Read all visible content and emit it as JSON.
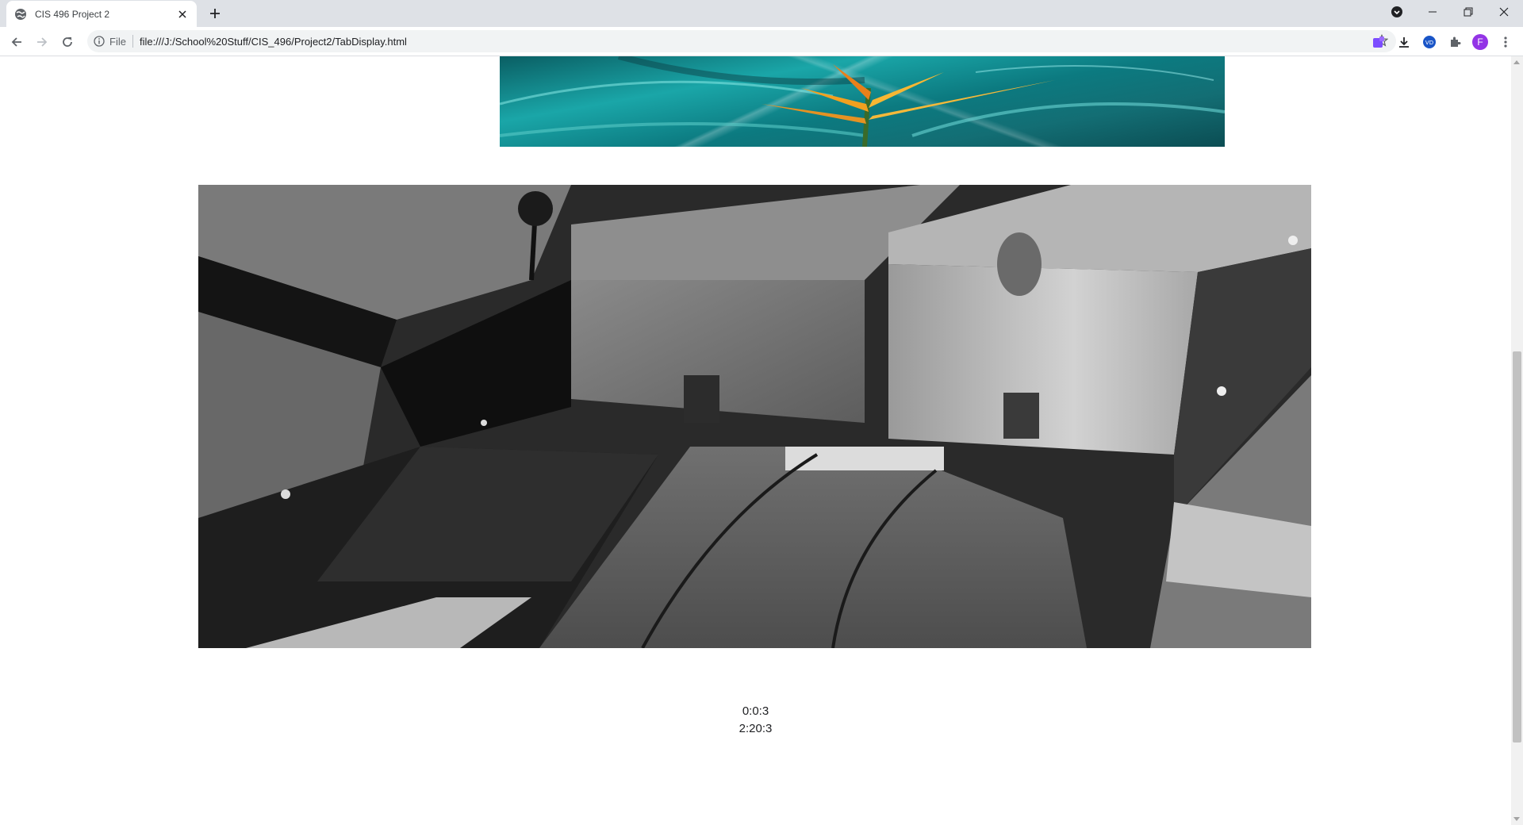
{
  "browser": {
    "tab_title": "CIS 496 Project 2",
    "address_chip": "File",
    "url": "file:///J:/School%20Stuff/CIS_496/Project2/TabDisplay.html",
    "profile_initial": "F"
  },
  "page": {
    "elapsed_time": "0:0:3",
    "total_time": "2:20:3"
  }
}
